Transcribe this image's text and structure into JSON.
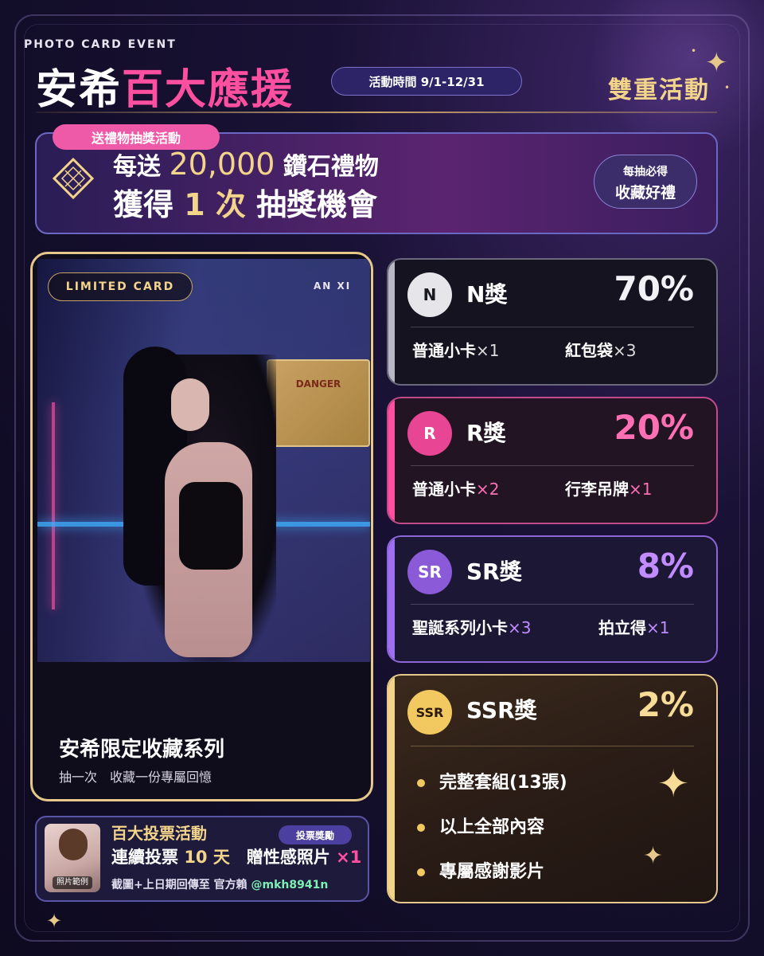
{
  "header": {
    "event_tag": "PHOTO CARD EVENT",
    "title_white": "安希",
    "title_pink": "百大應援",
    "period": "活動時間 9/1-12/31",
    "double": "雙重活動"
  },
  "banner": {
    "tag": "送禮物抽獎活動",
    "line1_pre": "每送 ",
    "line1_num": "20,000",
    "line1_post": " 鑽石禮物",
    "line2_pre": "獲得 ",
    "line2_num": "1 次",
    "line2_post": " 抽獎機會",
    "badge_small": "每抽必得",
    "badge_big": "收藏好禮"
  },
  "photo_card": {
    "tag": "LIMITED CARD",
    "model": "AN XI",
    "title": "安希限定收藏系列",
    "subtitle": "抽一次　收藏一份專屬回憶",
    "sign_text": "DANGER"
  },
  "vote": {
    "photo_label": "照片範例",
    "title": "百大投票活動",
    "badge": "投票獎勵",
    "line_pre": "連續投票 ",
    "line_days": "10 天",
    "line_mid": "　贈性感照片 ",
    "line_qty": "×1",
    "foot_pre": "截圖+上日期回傳至 官方賴 ",
    "foot_id": "@mkh8941n"
  },
  "prizes": {
    "n": {
      "badge": "N",
      "name": "N獎",
      "pct": "70%",
      "item1": "普通小卡",
      "q1": "×1",
      "item2": "紅包袋",
      "q2": "×3"
    },
    "r": {
      "badge": "R",
      "name": "R獎",
      "pct": "20%",
      "item1": "普通小卡",
      "q1": "×2",
      "item2": "行李吊牌",
      "q2": "×1"
    },
    "sr": {
      "badge": "SR",
      "name": "SR獎",
      "pct": "8%",
      "item1": "聖誕系列小卡",
      "q1": "×3",
      "item2": "拍立得",
      "q2": "×1"
    },
    "ssr": {
      "badge": "SSR",
      "name": "SSR獎",
      "pct": "2%",
      "bullets": [
        "完整套組(13張)",
        "以上全部內容",
        "專屬感謝影片"
      ]
    }
  },
  "colors": {
    "accent_pink": "#ff4fa0",
    "accent_gold": "#f2d48a",
    "accent_purple": "#a06ef0"
  },
  "icons": [
    "sparkle-icon",
    "diamond-icon",
    "dot-icon"
  ]
}
